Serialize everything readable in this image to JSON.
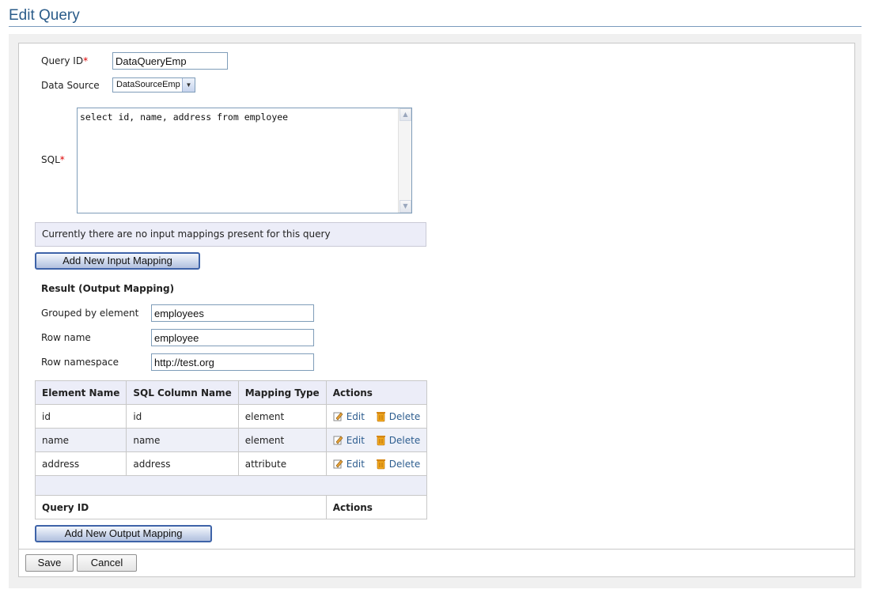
{
  "page": {
    "title": "Edit Query"
  },
  "form": {
    "query_id_label": "Query ID",
    "required_marker": "*",
    "query_id_value": "DataQueryEmp",
    "data_source_label": "Data Source",
    "data_source_value": "DataSourceEmp",
    "sql_label": "SQL",
    "sql_value": "select id, name, address from employee",
    "input_mapping_notice": "Currently there are no input mappings present for this query",
    "add_input_mapping_label": "Add New Input Mapping"
  },
  "result": {
    "heading": "Result (Output Mapping)",
    "grouped_by_label": "Grouped by element",
    "grouped_by_value": "employees",
    "row_name_label": "Row name",
    "row_name_value": "employee",
    "row_namespace_label": "Row namespace",
    "row_namespace_value": "http://test.org"
  },
  "mappings": {
    "headers": [
      "Element Name",
      "SQL Column Name",
      "Mapping Type",
      "Actions"
    ],
    "rows": [
      {
        "element": "id",
        "column": "id",
        "type": "element"
      },
      {
        "element": "name",
        "column": "name",
        "type": "element"
      },
      {
        "element": "address",
        "column": "address",
        "type": "attribute"
      }
    ],
    "edit_label": "Edit",
    "delete_label": "Delete",
    "footer_query_id": "Query ID",
    "footer_actions": "Actions",
    "add_output_mapping_label": "Add New Output Mapping"
  },
  "buttons": {
    "save": "Save",
    "cancel": "Cancel"
  },
  "colors": {
    "title": "#2b5c8a",
    "link": "#2d5d8f",
    "button_border": "#3e63a8",
    "header_bg": "#ecedf8"
  }
}
